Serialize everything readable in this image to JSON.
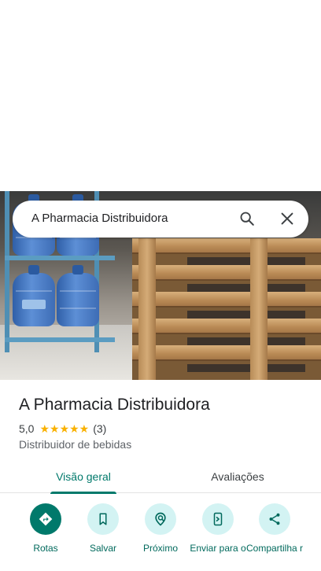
{
  "search": {
    "query": "A Pharmacia Distribuidora"
  },
  "place": {
    "name": "A Pharmacia Distribuidora",
    "rating": "5,0",
    "stars": "★★★★★",
    "review_count": "(3)",
    "category": "Distribuidor de bebidas"
  },
  "tabs": [
    {
      "label": "Visão geral",
      "selected": true
    },
    {
      "label": "Avaliações",
      "selected": false
    }
  ],
  "actions": [
    {
      "label": "Rotas",
      "icon": "directions-icon"
    },
    {
      "label": "Salvar",
      "icon": "bookmark-icon"
    },
    {
      "label": "Próximo",
      "icon": "nearby-icon"
    },
    {
      "label": "Enviar para o",
      "icon": "send-to-phone-icon"
    },
    {
      "label": "Compartilha r",
      "icon": "share-icon"
    }
  ],
  "colors": {
    "accent": "#00796b",
    "action_bg": "#d3f3f3",
    "star": "#f9b100"
  }
}
